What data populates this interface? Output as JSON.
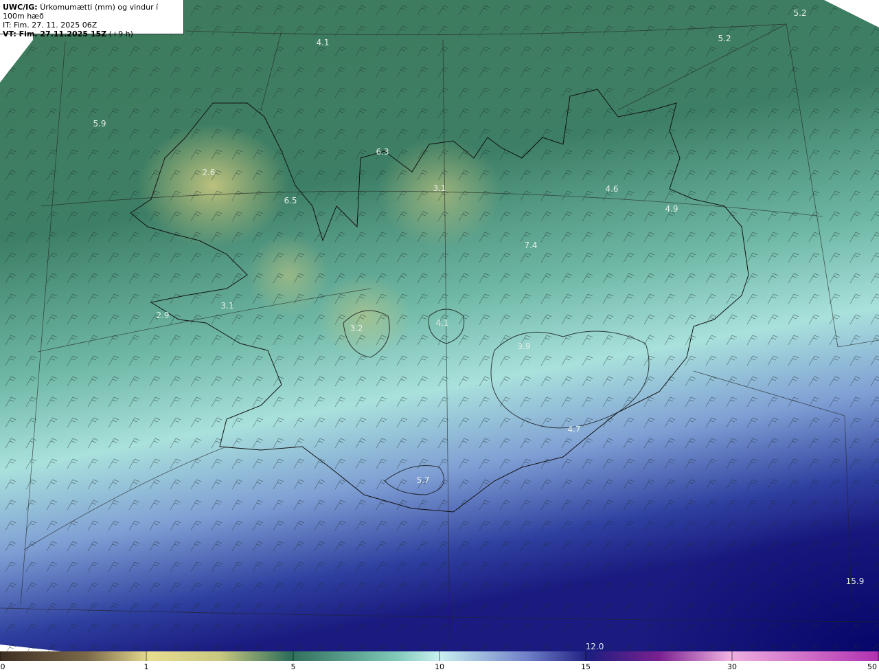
{
  "header": {
    "model_label": "UWC/IG:",
    "title": "Úrkomumætti (mm) og vindur í 100m hæð",
    "it_line": "IT: Fim. 27. 11. 2025 06Z",
    "vt_label": "VT: Fim. 27.11.2025 15Z",
    "vt_suffix": "(+9 h)"
  },
  "map_values": [
    {
      "id": "v1",
      "text": "5.2"
    },
    {
      "id": "v2",
      "text": "5.2"
    },
    {
      "id": "v3",
      "text": "4.1"
    },
    {
      "id": "v4",
      "text": "5.9"
    },
    {
      "id": "v5",
      "text": "6.3"
    },
    {
      "id": "v6",
      "text": "2.6"
    },
    {
      "id": "v7",
      "text": "6.5"
    },
    {
      "id": "v8",
      "text": "3.1"
    },
    {
      "id": "v9",
      "text": "4.6"
    },
    {
      "id": "v10",
      "text": "4.9"
    },
    {
      "id": "v11",
      "text": "7.4"
    },
    {
      "id": "v12",
      "text": "3.1"
    },
    {
      "id": "v13",
      "text": "2.9"
    },
    {
      "id": "v14",
      "text": "3.2"
    },
    {
      "id": "v15",
      "text": "4.1"
    },
    {
      "id": "v16",
      "text": "3.9"
    },
    {
      "id": "v17",
      "text": "4.7"
    },
    {
      "id": "v18",
      "text": "5.7"
    },
    {
      "id": "v19",
      "text": "15.9"
    },
    {
      "id": "v20",
      "text": "12.0"
    }
  ],
  "colorbar": {
    "ticks": [
      "0",
      "1",
      "5",
      "10",
      "15",
      "30",
      "50"
    ],
    "colors": [
      "#4a3a2a",
      "#9c8a62",
      "#f0e08a",
      "#2f6e5a",
      "#bfeeee",
      "#2a2a8a",
      "#7a2090",
      "#f0a0d8",
      "#c050c0"
    ]
  },
  "palette": {
    "sea_green": "#3c7e5c",
    "land_yellow": "#c8c880",
    "cyan": "#a8e4dc",
    "blue": "#2c3c9c",
    "navy": "#0a0a70"
  }
}
